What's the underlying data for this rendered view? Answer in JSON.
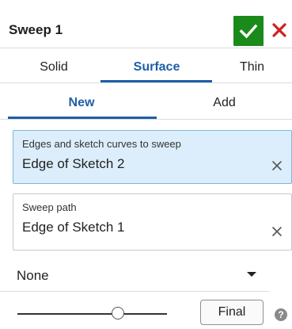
{
  "dialog": {
    "title": "Sweep 1"
  },
  "type_tabs": [
    {
      "label": "Solid",
      "active": false
    },
    {
      "label": "Surface",
      "active": true
    },
    {
      "label": "Thin",
      "active": false
    }
  ],
  "operation_tabs": [
    {
      "label": "New",
      "active": true
    },
    {
      "label": "Add",
      "active": false
    }
  ],
  "fields": {
    "edges": {
      "label": "Edges and sketch curves to sweep",
      "value": "Edge of Sketch 2",
      "active": true
    },
    "path": {
      "label": "Sweep path",
      "value": "Edge of Sketch 1",
      "active": false
    }
  },
  "profile_control": {
    "selected": "None"
  },
  "footer": {
    "final_label": "Final",
    "help_glyph": "?"
  },
  "colors": {
    "accent": "#1f5fa8",
    "ok_green": "#1a8a1a",
    "close_red": "#d02020",
    "active_field_bg": "#dceefb"
  },
  "icons": {
    "ok": "checkmark-icon",
    "close": "close-icon",
    "clear": "clear-x-icon",
    "dropdown": "caret-down-icon",
    "help": "help-icon"
  }
}
